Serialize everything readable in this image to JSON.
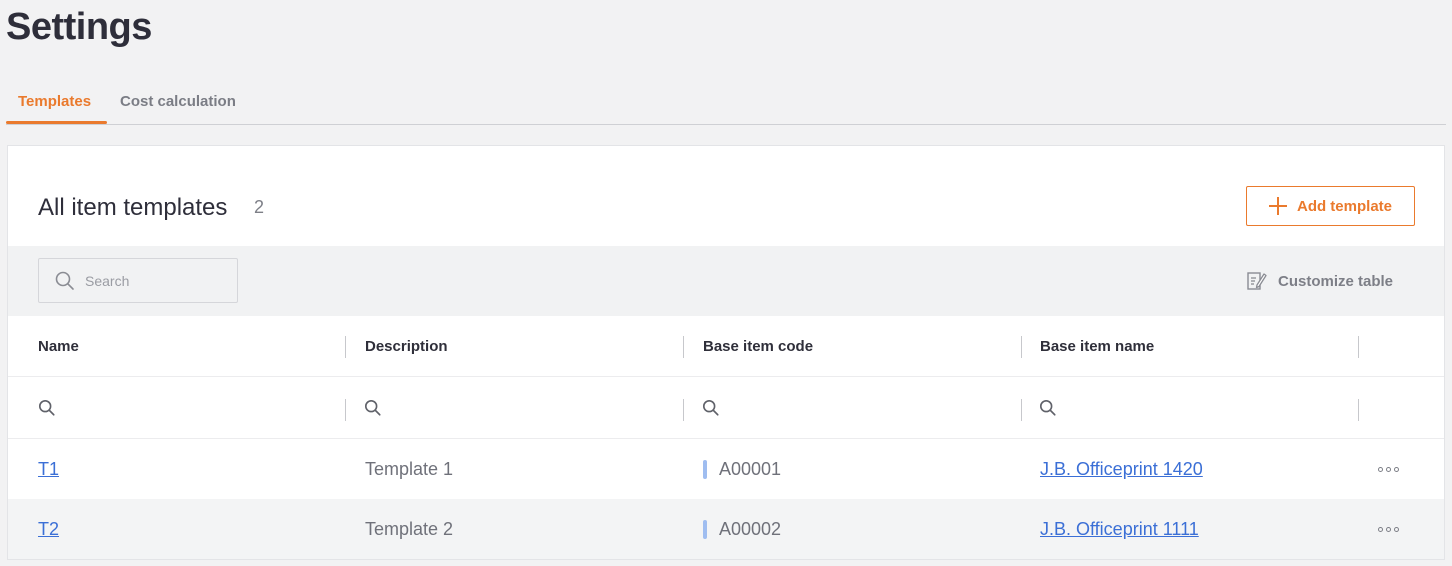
{
  "page": {
    "title": "Settings"
  },
  "tabs": [
    {
      "label": "Templates",
      "active": true
    },
    {
      "label": "Cost calculation",
      "active": false
    }
  ],
  "card": {
    "title": "All item templates",
    "count": "2",
    "add_button_label": "Add template"
  },
  "toolbar": {
    "search_placeholder": "Search",
    "customize_label": "Customize table"
  },
  "table": {
    "columns": [
      "Name",
      "Description",
      "Base item code",
      "Base item name"
    ],
    "rows": [
      {
        "name": "T1",
        "description": "Template 1",
        "code": "A00001",
        "base_name": "J.B. Officeprint 1420"
      },
      {
        "name": "T2",
        "description": "Template 2",
        "code": "A00002",
        "base_name": "J.B. Officeprint 1111"
      }
    ]
  },
  "colors": {
    "accent": "#ea7a2d",
    "link": "#3b6fd6",
    "code_marker": "#9fbdf0"
  },
  "icons": {
    "add": "plus-icon",
    "search": "search-icon",
    "customize": "edit-table-icon",
    "row_menu": "more-icon"
  }
}
